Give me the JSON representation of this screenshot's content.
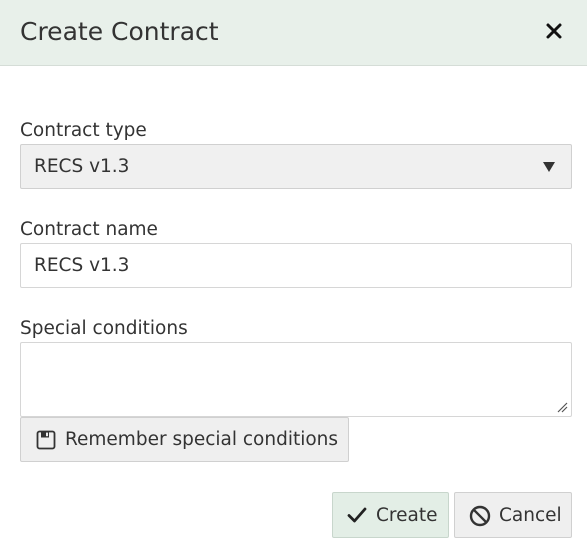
{
  "dialog": {
    "title": "Create Contract",
    "header_color": "#e8f0ea"
  },
  "form": {
    "contract_type": {
      "label": "Contract type",
      "selected": "RECS v1.3"
    },
    "contract_name": {
      "label": "Contract name",
      "value": "RECS v1.3"
    },
    "special_conditions": {
      "label": "Special conditions",
      "value": ""
    },
    "remember_button": {
      "label": "Remember special conditions",
      "icon": "save-icon"
    }
  },
  "actions": {
    "create": {
      "label": "Create",
      "icon": "check-icon",
      "color": "#e3eee6"
    },
    "cancel": {
      "label": "Cancel",
      "icon": "ban-icon"
    },
    "close_icon": "close-icon"
  }
}
